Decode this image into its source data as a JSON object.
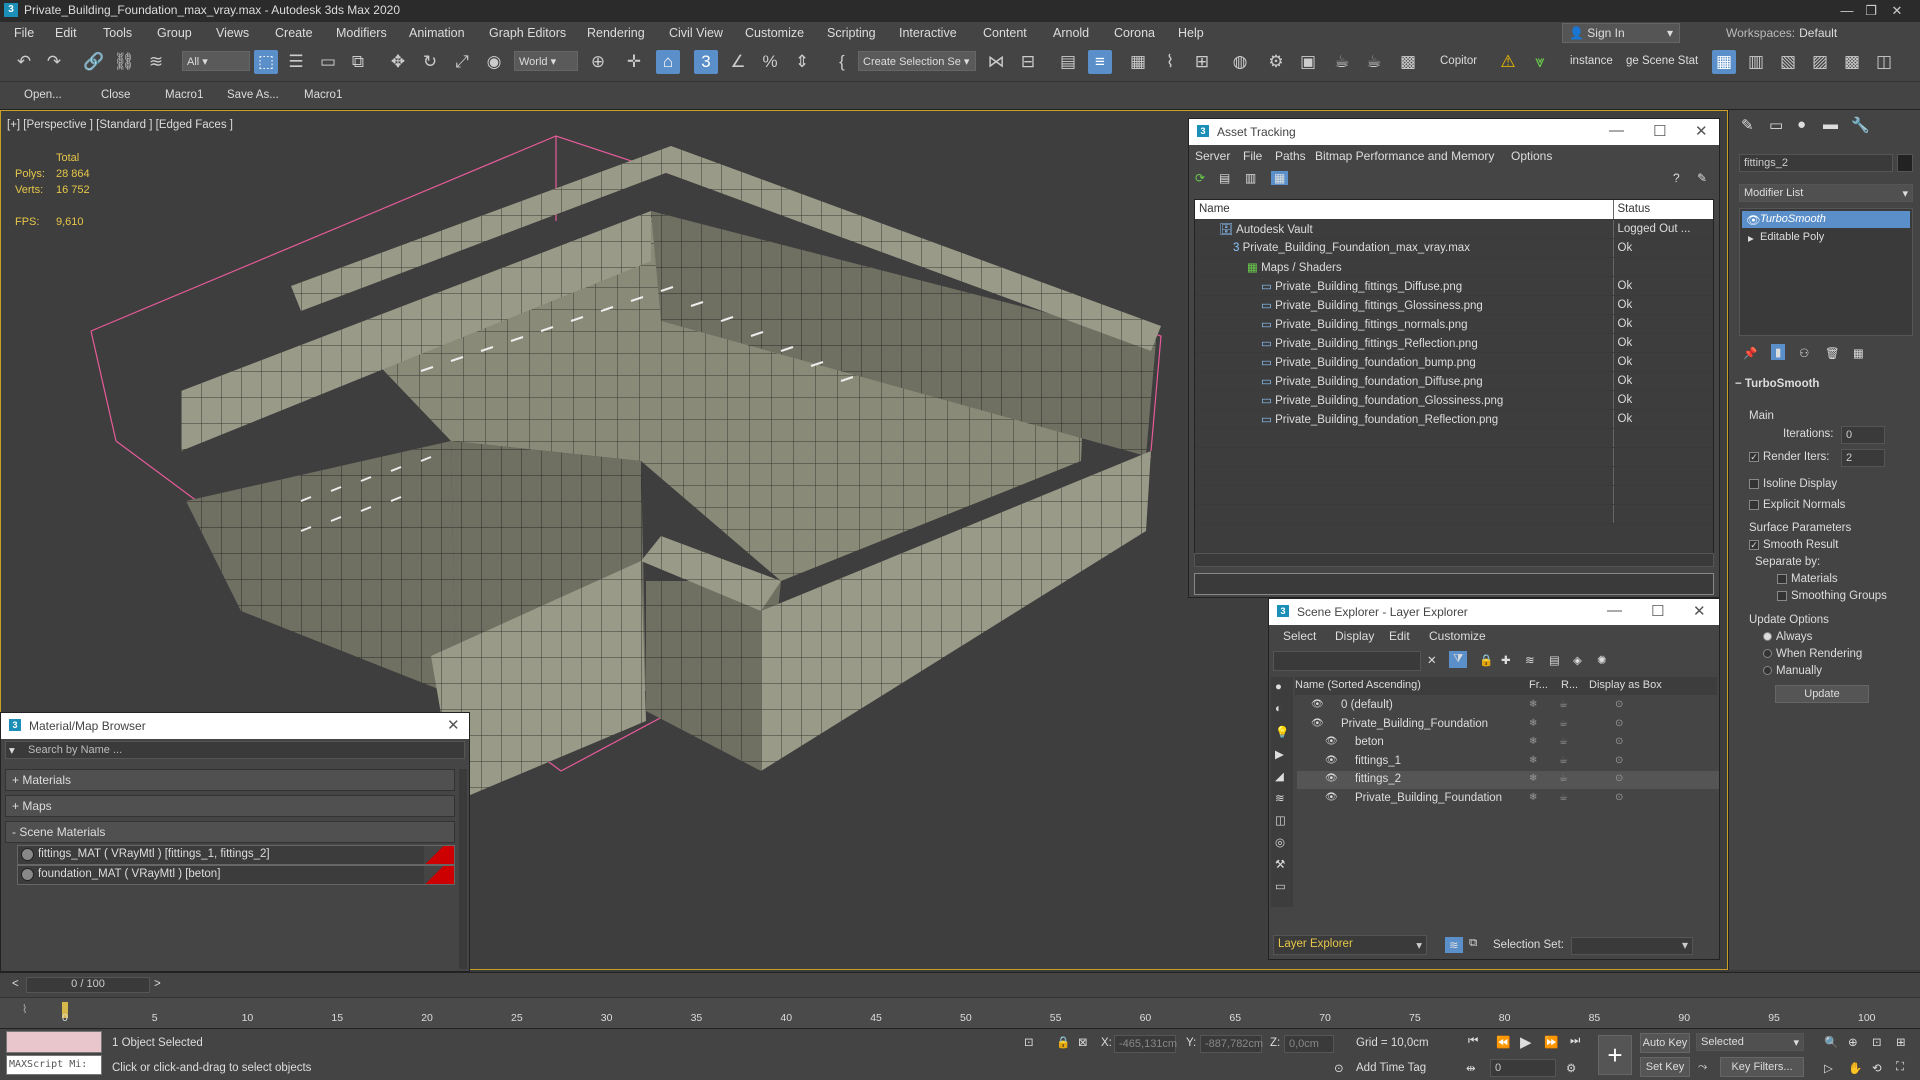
{
  "window": {
    "title": "Private_Building_Foundation_max_vray.max - Autodesk 3ds Max 2020"
  },
  "menu": [
    "File",
    "Edit",
    "Tools",
    "Group",
    "Views",
    "Create",
    "Modifiers",
    "Animation",
    "Graph Editors",
    "Rendering",
    "Civil View",
    "Customize",
    "Scripting",
    "Interactive",
    "Content",
    "Arnold",
    "Corona",
    "Help"
  ],
  "sign_in": "Sign In",
  "workspaces": {
    "label": "Workspaces:",
    "value": "Default"
  },
  "toolbar": {
    "filter": "All",
    "coord": "World",
    "selection_set": "Create Selection Se",
    "copitor": "Copitor",
    "instance": "instance",
    "scene_stat": "ge Scene Stat"
  },
  "macrobar": [
    "Open...",
    "Close",
    "Macro1",
    "Save As...",
    "Macro1"
  ],
  "viewport": {
    "label": "[+] [Perspective ] [Standard ] [Edged Faces ]",
    "stats": {
      "total_label": "Total",
      "polys_label": "Polys:",
      "polys": "28 864",
      "verts_label": "Verts:",
      "verts": "16 752",
      "fps_label": "FPS:",
      "fps": "9,610"
    }
  },
  "asset_tracking": {
    "title": "Asset Tracking",
    "menu": [
      "Server",
      "File",
      "Paths",
      "Bitmap Performance and Memory",
      "Options"
    ],
    "col_name": "Name",
    "col_status": "Status",
    "rows": [
      {
        "name": "Autodesk Vault",
        "status": "Logged Out ...",
        "indent": 0
      },
      {
        "name": "Private_Building_Foundation_max_vray.max",
        "status": "Ok",
        "indent": 1
      },
      {
        "name": "Maps / Shaders",
        "status": "",
        "indent": 2
      },
      {
        "name": "Private_Building_fittings_Diffuse.png",
        "status": "Ok",
        "indent": 3
      },
      {
        "name": "Private_Building_fittings_Glossiness.png",
        "status": "Ok",
        "indent": 3
      },
      {
        "name": "Private_Building_fittings_normals.png",
        "status": "Ok",
        "indent": 3
      },
      {
        "name": "Private_Building_fittings_Reflection.png",
        "status": "Ok",
        "indent": 3
      },
      {
        "name": "Private_Building_foundation_bump.png",
        "status": "Ok",
        "indent": 3
      },
      {
        "name": "Private_Building_foundation_Diffuse.png",
        "status": "Ok",
        "indent": 3
      },
      {
        "name": "Private_Building_foundation_Glossiness.png",
        "status": "Ok",
        "indent": 3
      },
      {
        "name": "Private_Building_foundation_Reflection.png",
        "status": "Ok",
        "indent": 3
      }
    ]
  },
  "scene_explorer": {
    "title": "Scene Explorer - Layer Explorer",
    "menu": [
      "Select",
      "Display",
      "Edit",
      "Customize"
    ],
    "col_name": "Name (Sorted Ascending)",
    "col_fr": "Fr...",
    "col_r": "R...",
    "col_box": "Display as Box",
    "rows": [
      {
        "name": "0 (default)",
        "indent": 0,
        "selected": false
      },
      {
        "name": "Private_Building_Foundation",
        "indent": 0,
        "selected": false
      },
      {
        "name": "beton",
        "indent": 1,
        "selected": false
      },
      {
        "name": "fittings_1",
        "indent": 1,
        "selected": false
      },
      {
        "name": "fittings_2",
        "indent": 1,
        "selected": true
      },
      {
        "name": "Private_Building_Foundation",
        "indent": 1,
        "selected": false
      }
    ],
    "footer_mode": "Layer Explorer",
    "selection_set_label": "Selection Set:"
  },
  "command_panel": {
    "object_name": "fittings_2",
    "modifier_list": "Modifier List",
    "stack": [
      "TurboSmooth",
      "Editable Poly"
    ],
    "rollout": "TurboSmooth",
    "main": "Main",
    "iterations_label": "Iterations:",
    "iterations": "0",
    "render_iters_label": "Render Iters:",
    "render_iters": "2",
    "isoline": "Isoline Display",
    "explicit": "Explicit Normals",
    "surface": "Surface Parameters",
    "smooth_result": "Smooth Result",
    "separate_by": "Separate by:",
    "materials": "Materials",
    "smoothing_groups": "Smoothing Groups",
    "update_options": "Update Options",
    "always": "Always",
    "when_rendering": "When Rendering",
    "manually": "Manually",
    "update_btn": "Update"
  },
  "material_browser": {
    "title": "Material/Map Browser",
    "search_placeholder": "Search by Name ...",
    "sections": [
      "+ Materials",
      "+ Maps",
      "- Scene Materials"
    ],
    "materials": [
      "fittings_MAT ( VRayMtl ) [fittings_1, fittings_2]",
      "foundation_MAT ( VRayMtl ) [beton]"
    ]
  },
  "timeline": {
    "frame": "0 / 100",
    "ticks": [
      "0",
      "5",
      "10",
      "15",
      "20",
      "25",
      "30",
      "35",
      "40",
      "45",
      "50",
      "55",
      "60",
      "65",
      "70",
      "75",
      "80",
      "85",
      "90",
      "95",
      "100"
    ]
  },
  "status": {
    "maxscript": "MAXScript Mi:",
    "selected": "1 Object Selected",
    "prompt": "Click or click-and-drag to select objects",
    "x_label": "X:",
    "x": "-465,131cm",
    "y_label": "Y:",
    "y": "-887,782cm",
    "z_label": "Z:",
    "z": "0,0cm",
    "grid": "Grid = 10,0cm",
    "add_time_tag": "Add Time Tag",
    "auto_key": "Auto Key",
    "set_key": "Set Key",
    "selected_dd": "Selected",
    "key_filters": "Key Filters...",
    "frame_field": "0"
  }
}
